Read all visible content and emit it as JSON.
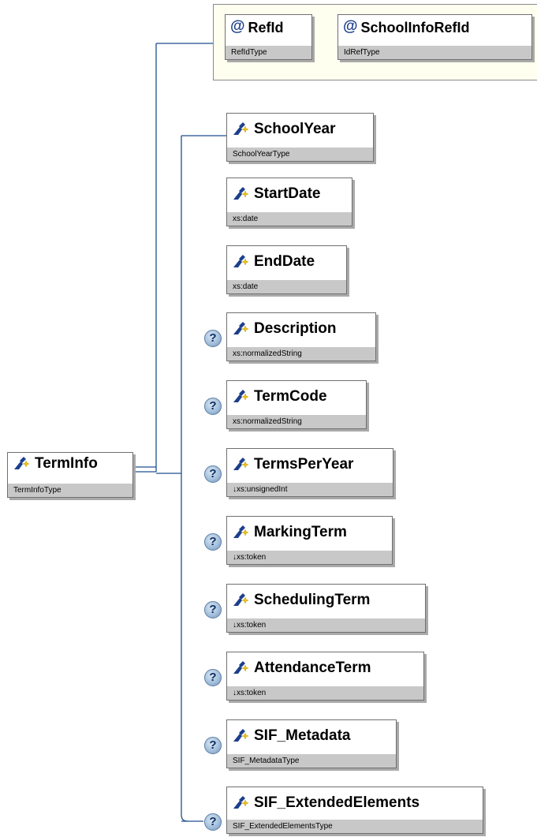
{
  "root": {
    "name": "TermInfo",
    "type": "TermInfoType"
  },
  "attributes": [
    {
      "name": "RefId",
      "type": "RefIdType"
    },
    {
      "name": "SchoolInfoRefId",
      "type": "IdRefType"
    }
  ],
  "elements": [
    {
      "name": "SchoolYear",
      "type": "SchoolYearType",
      "optional": false
    },
    {
      "name": "StartDate",
      "type": "xs:date",
      "optional": false
    },
    {
      "name": "EndDate",
      "type": "xs:date",
      "optional": false
    },
    {
      "name": "Description",
      "type": "xs:normalizedString",
      "optional": true
    },
    {
      "name": "TermCode",
      "type": "xs:normalizedString",
      "optional": true
    },
    {
      "name": "TermsPerYear",
      "type": "↓xs:unsignedInt",
      "optional": true
    },
    {
      "name": "MarkingTerm",
      "type": "↓xs:token",
      "optional": true
    },
    {
      "name": "SchedulingTerm",
      "type": "↓xs:token",
      "optional": true
    },
    {
      "name": "AttendanceTerm",
      "type": "↓xs:token",
      "optional": true
    },
    {
      "name": "SIF_Metadata",
      "type": "SIF_MetadataType",
      "optional": true
    },
    {
      "name": "SIF_ExtendedElements",
      "type": "SIF_ExtendedElementsType",
      "optional": true
    }
  ],
  "icons": {
    "attribute": "at-sign-icon",
    "element": "element-icon",
    "optional": "question-mark-icon",
    "optional_glyph": "?",
    "attribute_glyph": "@"
  },
  "colors": {
    "connector": "#1f4f8f",
    "type_band": "#c8c8c8",
    "attribute_group_bg": "#fffff0",
    "element_icon_blue": "#1c3f8c",
    "element_icon_yellow": "#f2c200"
  }
}
